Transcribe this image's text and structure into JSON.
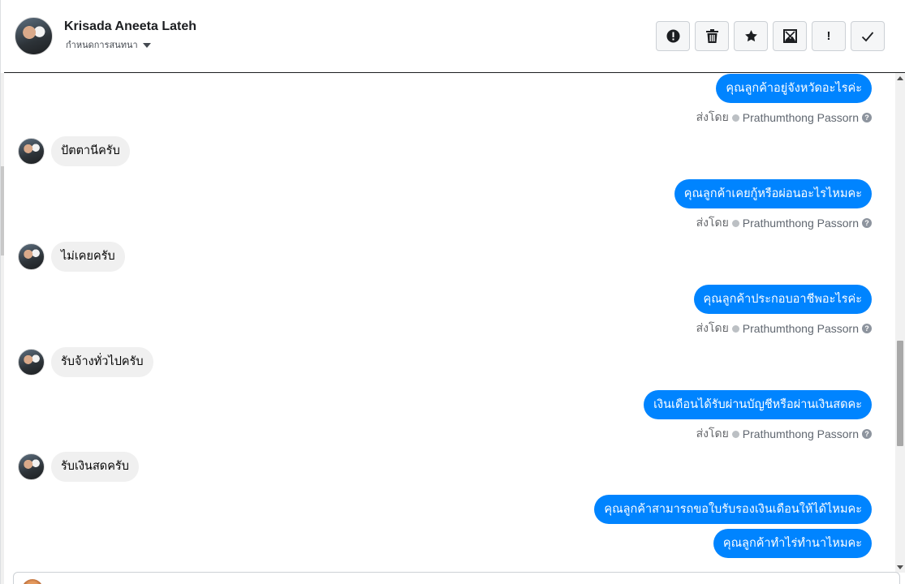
{
  "header": {
    "contact_name": "Krisada Aneeta Lateh",
    "assign_label": "กำหนดการสนทนา",
    "toolbar": [
      {
        "icon": "alert-circle-icon",
        "glyph": "!"
      },
      {
        "icon": "trash-icon",
        "glyph": ""
      },
      {
        "icon": "star-icon",
        "glyph": "★"
      },
      {
        "icon": "image-remove-icon",
        "glyph": ""
      },
      {
        "icon": "exclamation-icon",
        "glyph": "!"
      },
      {
        "icon": "check-icon",
        "glyph": "✓"
      }
    ]
  },
  "messages": [
    {
      "dir": "out",
      "text": "คุณลูกค้าอยู่จังหวัดอะไรค่ะ",
      "sent_by_label": "ส่งโดย",
      "agent": "Prathumthong Passorn"
    },
    {
      "dir": "in",
      "text": "ปัตตานีครับ"
    },
    {
      "dir": "out",
      "text": "คุณลูกค้าเคยกู้หรือผ่อนอะไรไหมคะ",
      "sent_by_label": "ส่งโดย",
      "agent": "Prathumthong Passorn"
    },
    {
      "dir": "in",
      "text": "ไม่เคยครับ"
    },
    {
      "dir": "out",
      "text": "คุณลูกค้าประกอบอาชีพอะไรค่ะ",
      "sent_by_label": "ส่งโดย",
      "agent": "Prathumthong Passorn"
    },
    {
      "dir": "in",
      "text": "รับจ้างทั่วไปครับ"
    },
    {
      "dir": "out",
      "text": "เงินเดือนได้รับผ่านบัญชีหรือผ่านเงินสดคะ",
      "sent_by_label": "ส่งโดย",
      "agent": "Prathumthong Passorn"
    },
    {
      "dir": "in",
      "text": "รับเงินสดครับ"
    },
    {
      "dir": "out",
      "text": "คุณลูกค้าสามารถขอใบรับรองเงินเดือนให้ได้ไหมคะ"
    },
    {
      "dir": "out",
      "text": "คุณลูกค้าทำไร่ทำนาไหมคะ"
    }
  ],
  "colors": {
    "outgoing_bubble": "#0084ff",
    "incoming_bubble": "#f0f0f0"
  }
}
